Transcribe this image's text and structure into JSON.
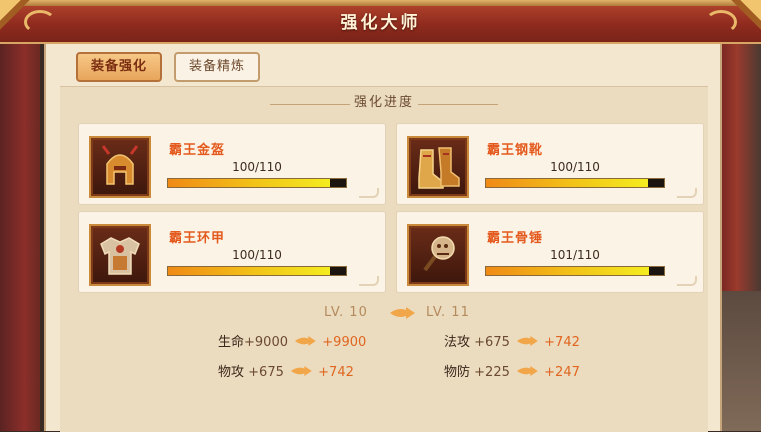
{
  "title": "强化大师",
  "tabs": [
    {
      "label": "装备强化",
      "active": true
    },
    {
      "label": "装备精炼",
      "active": false
    }
  ],
  "section_title": "强化进度",
  "equipment": [
    {
      "name": "霸王金盔",
      "current": 100,
      "max": 110,
      "progress_text": "100/110",
      "icon": "helmet-icon"
    },
    {
      "name": "霸王钢靴",
      "current": 100,
      "max": 110,
      "progress_text": "100/110",
      "icon": "boots-icon"
    },
    {
      "name": "霸王环甲",
      "current": 100,
      "max": 110,
      "progress_text": "100/110",
      "icon": "armor-icon"
    },
    {
      "name": "霸王骨锤",
      "current": 101,
      "max": 110,
      "progress_text": "101/110",
      "icon": "hammer-icon"
    }
  ],
  "level": {
    "from": "LV. 10",
    "to": "LV. 11"
  },
  "stats": [
    {
      "label": "生命",
      "from": "+9000",
      "to": "+9900"
    },
    {
      "label": "法攻",
      "from": "+675",
      "to": "+742"
    },
    {
      "label": "物攻",
      "from": "+675",
      "to": "+742"
    },
    {
      "label": "物防",
      "from": "+225",
      "to": "+247"
    }
  ],
  "colors": {
    "accent": "#e45a1e",
    "bar_start": "#f08a16",
    "bar_end": "#f4ec20",
    "title_bar": "#8e2a1e"
  }
}
